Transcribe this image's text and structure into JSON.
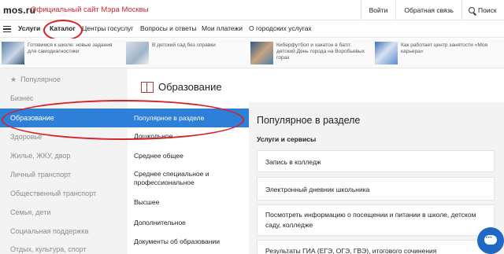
{
  "header": {
    "logo": "mos.ru",
    "site_title": "Официальный сайт Мэра Москвы",
    "links": [
      "Войти",
      "Обратная связь"
    ],
    "search_label": "Поиск"
  },
  "nav": {
    "items": [
      "Услуги",
      "Каталог",
      "Центры госуслуг",
      "Вопросы и ответы",
      "Мои платежи",
      "О городских услугах"
    ]
  },
  "news": [
    {
      "text": "Готовимся к школе: новые задания для самодиагностики"
    },
    {
      "text": "В детский сад без справки"
    },
    {
      "text": "Киберфутбол и хакатон в батл: детский День города на Воробьевых горах"
    },
    {
      "text": "Как работает центр занятости «Моя карьера»"
    }
  ],
  "sidebar": {
    "items": [
      "Популярное",
      "Бизнес",
      "Образование",
      "Здоровье",
      "Жилье, ЖКУ, двор",
      "Личный транспорт",
      "Общественный транспорт",
      "Семья, дети",
      "Социальная поддержка",
      "Отдых, культура, спорт"
    ]
  },
  "section": {
    "title": "Образование",
    "items": [
      "Популярное в разделе",
      "Дошкольное",
      "Среднее общее",
      "Среднее специальное и профессиональное",
      "Высшее",
      "Дополнительное",
      "Документы об образовании"
    ]
  },
  "panel": {
    "title": "Популярное в разделе",
    "subtitle": "Услуги и сервисы",
    "cards": [
      "Запись в колледж",
      "Электронный дневник школьника",
      "Посмотреть информацию о посещении и питании в школе, детском саду, колледже",
      "Результаты ГИА (ЕГЭ, ОГЭ, ГВЭ), итогового сочинения"
    ]
  },
  "colors": {
    "accent": "#2e7fd7",
    "brand_red": "#d1242f",
    "annotation_red": "#d6202b"
  }
}
